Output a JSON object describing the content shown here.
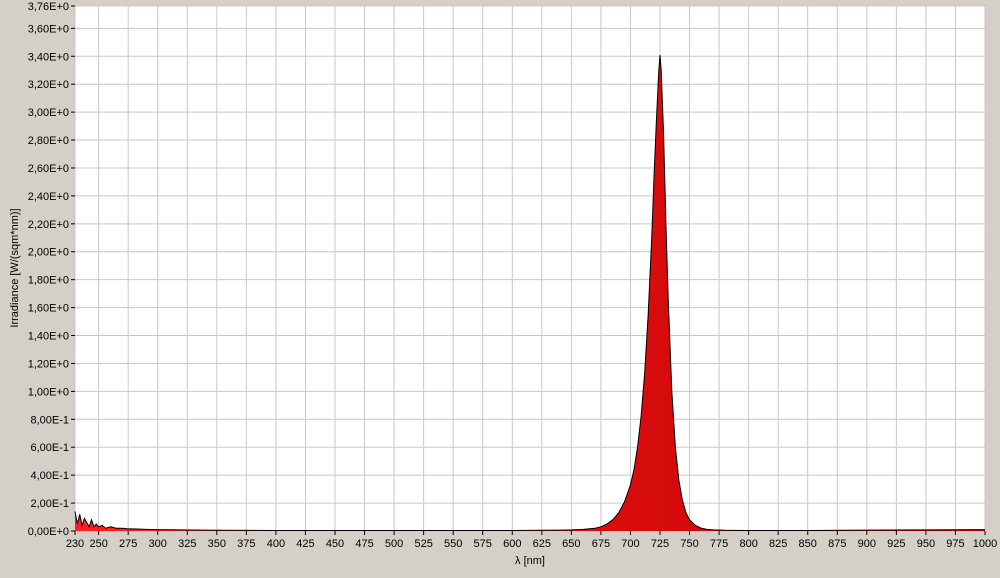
{
  "colors": {
    "background": "#d4d0c8",
    "plot_background": "#ffffff",
    "grid": "#c8c8c8",
    "fill": "#ff2020",
    "fill_dark": "#c00000",
    "outline": "#000000"
  },
  "chart_data": {
    "type": "area",
    "title": "",
    "xlabel": "λ [nm]",
    "ylabel": "Irradiance [W/(sqm*nm)]",
    "xlim": [
      230,
      1000
    ],
    "ylim": [
      0,
      3.76
    ],
    "grid": true,
    "x_ticks": [
      230,
      250,
      275,
      300,
      325,
      350,
      375,
      400,
      425,
      450,
      475,
      500,
      525,
      550,
      575,
      600,
      625,
      650,
      675,
      700,
      725,
      750,
      775,
      800,
      825,
      850,
      875,
      900,
      925,
      950,
      975,
      1000
    ],
    "x_tick_labels": [
      "230",
      "250",
      "275",
      "300",
      "325",
      "350",
      "375",
      "400",
      "425",
      "450",
      "475",
      "500",
      "525",
      "550",
      "575",
      "600",
      "625",
      "650",
      "675",
      "700",
      "725",
      "750",
      "775",
      "800",
      "825",
      "850",
      "875",
      "900",
      "925",
      "950",
      "975",
      "1000"
    ],
    "y_ticks": [
      0,
      0.2,
      0.4,
      0.6,
      0.8,
      1.0,
      1.2,
      1.4,
      1.6,
      1.8,
      2.0,
      2.2,
      2.4,
      2.6,
      2.8,
      3.0,
      3.2,
      3.4,
      3.6,
      3.76
    ],
    "y_tick_labels": [
      "0,00E+0",
      "2,00E-1",
      "4,00E-1",
      "6,00E-1",
      "8,00E-1",
      "1,00E+0",
      "1,20E+0",
      "1,40E+0",
      "1,60E+0",
      "1,80E+0",
      "2,00E+0",
      "2,20E+0",
      "2,40E+0",
      "2,60E+0",
      "2,80E+0",
      "3,00E+0",
      "3,20E+0",
      "3,40E+0",
      "3,60E+0",
      "3,76E+0"
    ],
    "series": [
      {
        "x": [
          230,
          232,
          234,
          236,
          238,
          240,
          242,
          244,
          246,
          248,
          250,
          253,
          256,
          260,
          265,
          270,
          275,
          280,
          290,
          300,
          320,
          350,
          400,
          450,
          500,
          550,
          600,
          625,
          640,
          650,
          660,
          670,
          675,
          680,
          685,
          690,
          695,
          700,
          703,
          706,
          709,
          712,
          715,
          718,
          720,
          722,
          724,
          725,
          726,
          728,
          730,
          732,
          735,
          738,
          741,
          744,
          747,
          750,
          755,
          760,
          765,
          770,
          780,
          800,
          850,
          900,
          950,
          1000
        ],
        "values": [
          0.14,
          0.05,
          0.12,
          0.04,
          0.09,
          0.06,
          0.03,
          0.08,
          0.03,
          0.05,
          0.03,
          0.04,
          0.02,
          0.03,
          0.02,
          0.02,
          0.015,
          0.015,
          0.012,
          0.01,
          0.008,
          0.005,
          0.004,
          0.004,
          0.004,
          0.004,
          0.004,
          0.005,
          0.006,
          0.008,
          0.012,
          0.02,
          0.03,
          0.05,
          0.08,
          0.13,
          0.21,
          0.33,
          0.44,
          0.6,
          0.82,
          1.13,
          1.55,
          2.1,
          2.55,
          2.95,
          3.3,
          3.41,
          3.3,
          2.85,
          2.2,
          1.65,
          1.0,
          0.6,
          0.36,
          0.22,
          0.13,
          0.08,
          0.04,
          0.02,
          0.012,
          0.008,
          0.005,
          0.004,
          0.004,
          0.006,
          0.008,
          0.01
        ]
      }
    ]
  }
}
